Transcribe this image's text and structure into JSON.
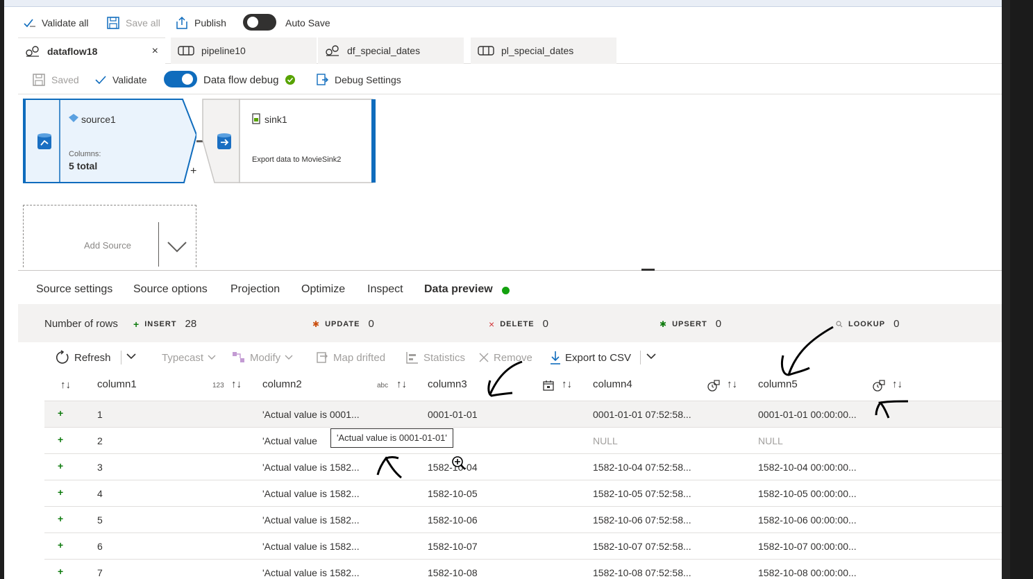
{
  "toolbar": {
    "validate_all": "Validate all",
    "save_all": "Save all",
    "publish": "Publish",
    "auto_save": "Auto Save"
  },
  "tabs": [
    {
      "label": "dataflow18",
      "close": "×"
    },
    {
      "label": "pipeline10"
    },
    {
      "label": "df_special_dates"
    },
    {
      "label": "pl_special_dates"
    }
  ],
  "subtoolbar": {
    "saved": "Saved",
    "validate": "Validate",
    "debug": "Data flow debug",
    "debug_settings": "Debug Settings"
  },
  "canvas": {
    "source": {
      "name": "source1",
      "columns_label": "Columns:",
      "columns_value": "5 total",
      "add": "+"
    },
    "sink": {
      "name": "sink1",
      "desc": "Export data to MovieSink2"
    },
    "add_source": "Add Source"
  },
  "panel_tabs": [
    "Source settings",
    "Source options",
    "Projection",
    "Optimize",
    "Inspect",
    "Data preview"
  ],
  "stats": {
    "label": "Number of rows",
    "insert_k": "INSERT",
    "insert_v": "28",
    "update_k": "UPDATE",
    "update_v": "0",
    "delete_k": "DELETE",
    "delete_v": "0",
    "upsert_k": "UPSERT",
    "upsert_v": "0",
    "lookup_k": "LOOKUP",
    "lookup_v": "0"
  },
  "preview_toolbar": {
    "refresh": "Refresh",
    "typecast": "Typecast",
    "modify": "Modify",
    "map_drifted": "Map drifted",
    "statistics": "Statistics",
    "remove": "Remove",
    "export": "Export to CSV"
  },
  "columns": [
    {
      "name": "column1",
      "type": "123"
    },
    {
      "name": "column2",
      "type": "abc"
    },
    {
      "name": "column3"
    },
    {
      "name": "column4"
    },
    {
      "name": "column5"
    }
  ],
  "rows": [
    [
      "1",
      "'Actual value is 0001...",
      "0001-01-01",
      "0001-01-01 07:52:58...",
      "0001-01-01 00:00:00..."
    ],
    [
      "2",
      "'Actual value",
      "",
      "NULL",
      "NULL"
    ],
    [
      "3",
      "'Actual value is 1582...",
      "1582-10-04",
      "1582-10-04 07:52:58...",
      "1582-10-04 00:00:00..."
    ],
    [
      "4",
      "'Actual value is 1582...",
      "1582-10-05",
      "1582-10-05 07:52:58...",
      "1582-10-05 00:00:00..."
    ],
    [
      "5",
      "'Actual value is 1582...",
      "1582-10-06",
      "1582-10-06 07:52:58...",
      "1582-10-06 00:00:00..."
    ],
    [
      "6",
      "'Actual value is 1582...",
      "1582-10-07",
      "1582-10-07 07:52:58...",
      "1582-10-07 00:00:00..."
    ],
    [
      "7",
      "'Actual value is 1582...",
      "1582-10-08",
      "1582-10-08 07:52:58...",
      "1582-10-08 00:00:00..."
    ]
  ],
  "tooltip": "'Actual value is 0001-01-01'",
  "row_marker": "+"
}
